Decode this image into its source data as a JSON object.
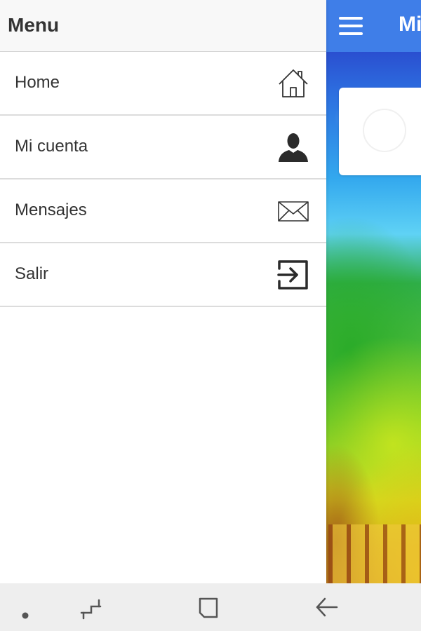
{
  "app": {
    "title": "Mi"
  },
  "drawer": {
    "title": "Menu",
    "items": [
      {
        "label": "Home",
        "icon": "home-icon"
      },
      {
        "label": "Mi cuenta",
        "icon": "account-icon"
      },
      {
        "label": "Mensajes",
        "icon": "mail-icon"
      },
      {
        "label": "Salir",
        "icon": "logout-icon"
      }
    ]
  },
  "system_nav": {
    "buttons": [
      "dot-icon",
      "recent-apps-icon",
      "home-square-icon",
      "back-arrow-icon"
    ]
  },
  "colors": {
    "header_blue": "#3f7ee8",
    "drawer_header_bg": "#f8f8f8",
    "text": "#333333",
    "nav_bar": "#eeeeee"
  }
}
